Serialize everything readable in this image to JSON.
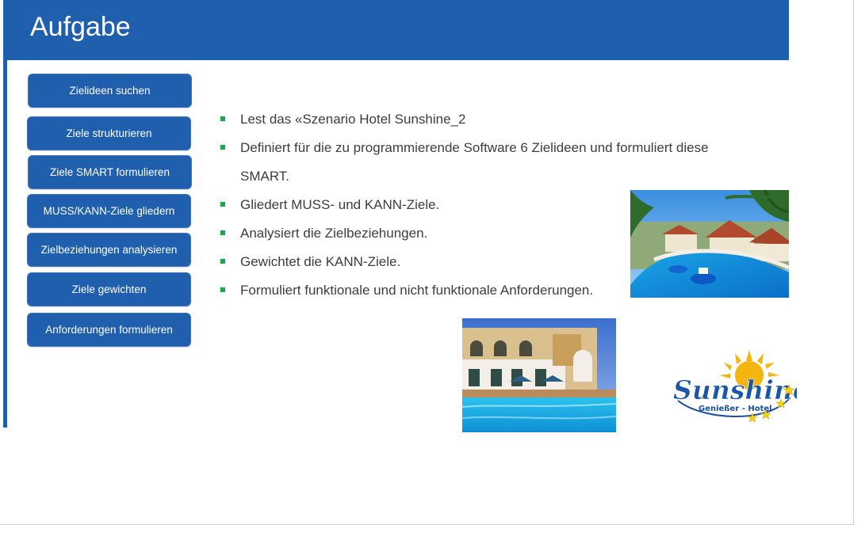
{
  "slide": {
    "title": "Aufgabe"
  },
  "nav_buttons": [
    "Zielideen suchen",
    "Ziele strukturieren",
    "Ziele SMART formulieren",
    "MUSS/KANN-Ziele gliedern",
    "Zielbeziehungen analysieren",
    "Ziele gewichten",
    "Anforderungen formulieren"
  ],
  "tasks": [
    "Lest das «Szenario Hotel Sunshine_2",
    "Definiert für die zu programmierende Software 6 Zielideen und formuliert diese",
    "SMART.",
    "Gliedert MUSS- und KANN-Ziele.",
    "Analysiert die Zielbeziehungen.",
    "Gewichtet die KANN-Ziele.",
    "Formuliert funktionale und nicht funktionale Anforderungen."
  ],
  "logo": {
    "name": "Sunshine",
    "tagline": "Genießer - Hotel"
  },
  "colors": {
    "primary": "#1f5fae",
    "bullet": "#17a84a",
    "text": "#3d3d3d",
    "sun": "#f5b50f"
  }
}
